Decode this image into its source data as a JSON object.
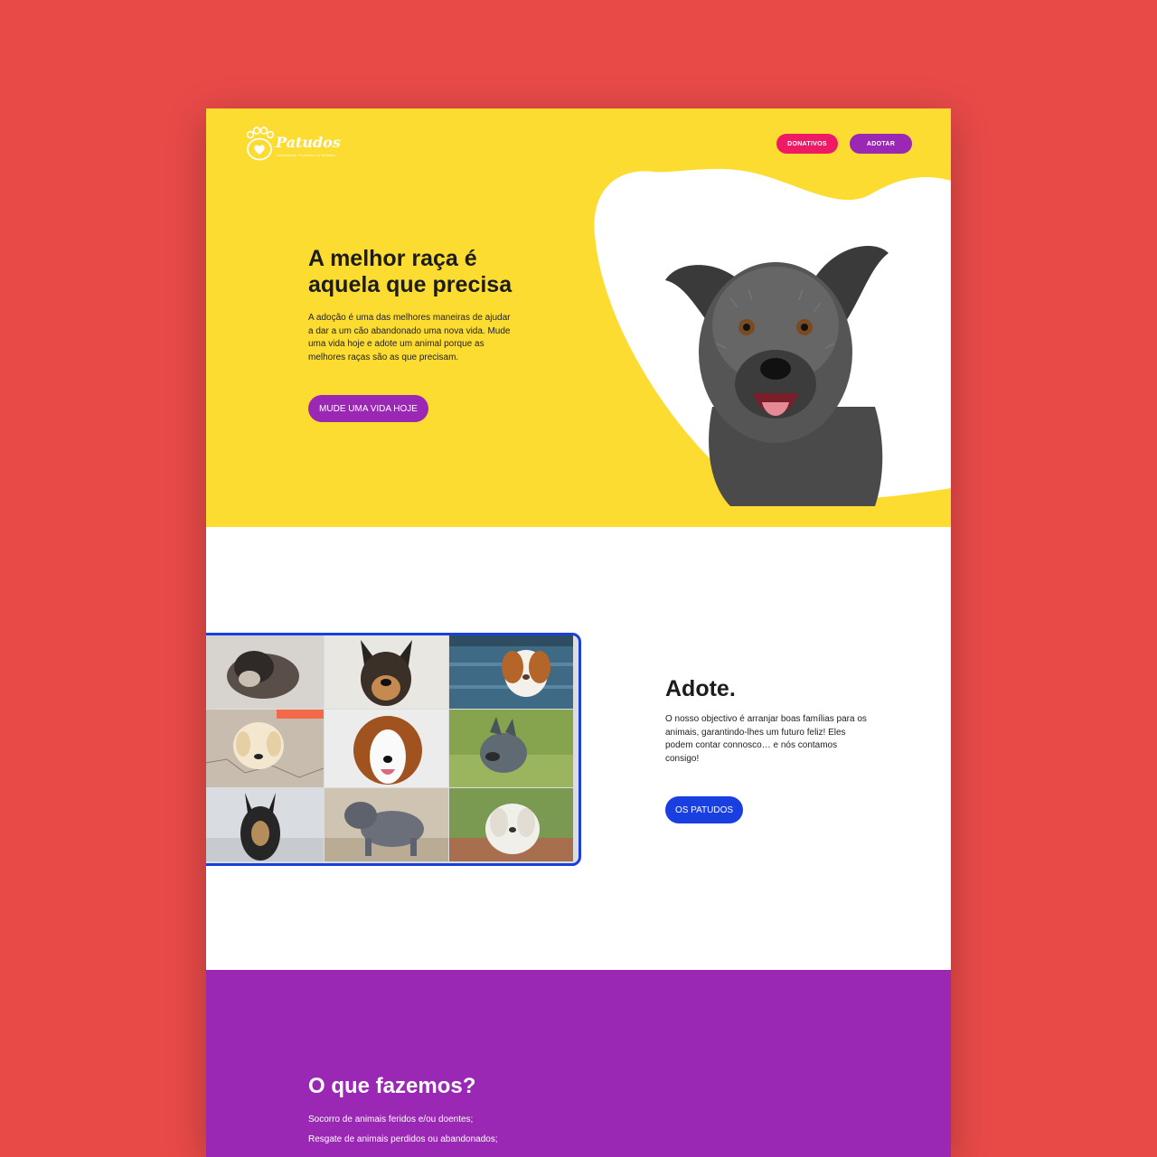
{
  "brand": {
    "name": "Patudos",
    "tagline": "Associação Protetora de Animais"
  },
  "nav": {
    "donativos_label": "DONATIVOS",
    "adotar_label": "ADOTAR"
  },
  "hero": {
    "title_line1": "A melhor raça é",
    "title_line2": "aquela que precisa",
    "text": "A adoção é uma das melhores maneiras de ajudar a dar a um cão abandonado uma nova vida. Mude uma vida hoje e adote um animal porque as melhores raças são as que precisam.",
    "cta_label": "MUDE UMA VIDA HOJE"
  },
  "adopt": {
    "title": "Adote.",
    "text": "O nosso objectivo é arranjar boas famílias para os animais, garantindo-lhes um futuro feliz! Eles podem contar connosco… e nós contamos consigo!",
    "cta_label": "OS PATUDOS"
  },
  "what": {
    "title": "O que fazemos?",
    "items": [
      "Socorro de animais feridos e/ou doentes;",
      "Resgate de animais perdidos ou abandonados;"
    ]
  },
  "colors": {
    "background": "#e84a48",
    "hero_yellow": "#fddc32",
    "purple": "#9b27b5",
    "pink": "#ee1a66",
    "blue": "#1a3fe0"
  },
  "icons": {
    "logo": "paw-heart-icon"
  }
}
